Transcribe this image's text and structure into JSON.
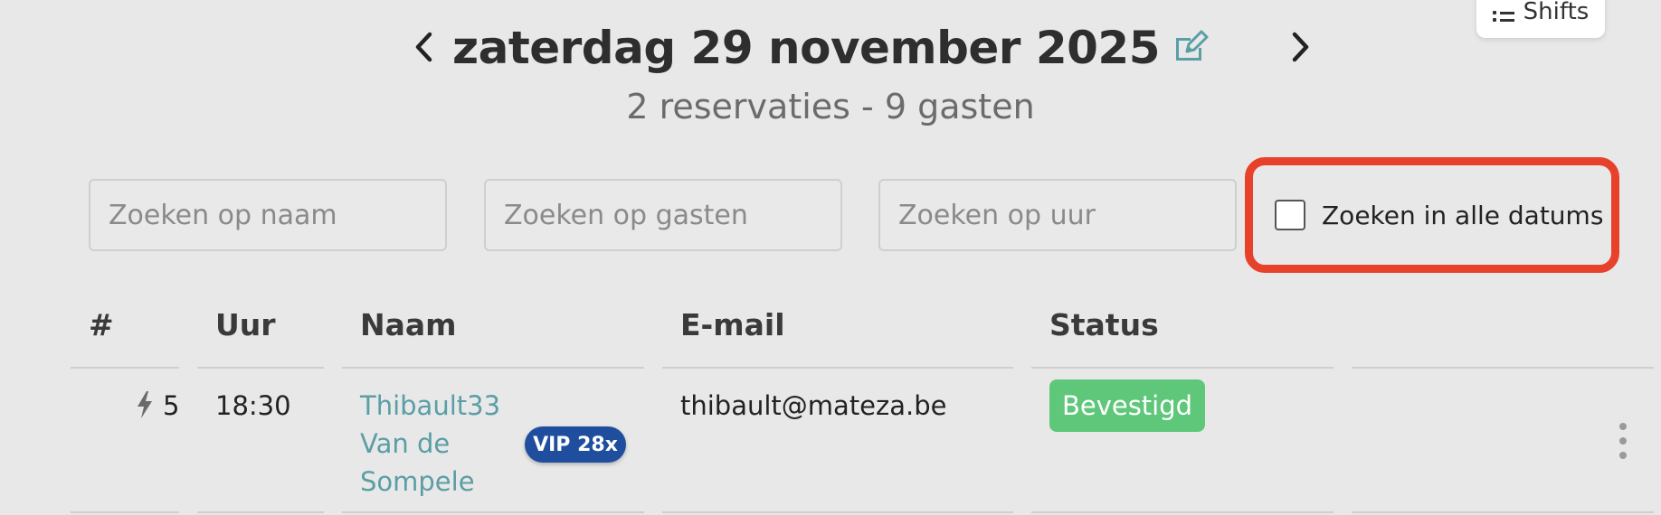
{
  "header": {
    "shifts_button": "Shifts",
    "date_title": "zaterdag 29 november 2025",
    "summary": "2 reservaties - 9 gasten"
  },
  "filters": {
    "name_placeholder": "Zoeken op naam",
    "guests_placeholder": "Zoeken op gasten",
    "time_placeholder": "Zoeken op uur",
    "all_dates_label": "Zoeken in alle datums",
    "all_dates_checked": false
  },
  "table": {
    "columns": [
      "#",
      "Uur",
      "Naam",
      "E-mail",
      "Status",
      ""
    ],
    "rows": [
      {
        "guests": "5",
        "time": "18:30",
        "name": "Thibault33 Van de Sompele",
        "badge": "VIP 28x",
        "email": "thibault@mateza.be",
        "status": "Bevestigd"
      }
    ]
  },
  "colors": {
    "accent": "#5a9ea6",
    "status_confirmed": "#5fc77a",
    "vip_badge": "#1f4e9e",
    "highlight": "#e8412b"
  }
}
